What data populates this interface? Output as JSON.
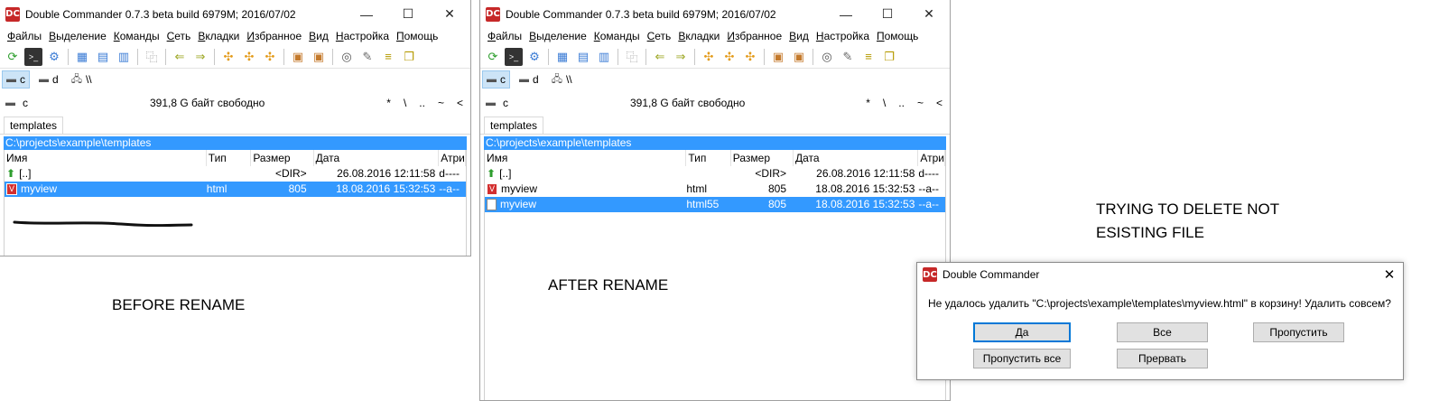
{
  "windows": [
    {
      "title": "Double Commander 0.7.3 beta build 6979M; 2016/07/02",
      "menu": [
        "Файлы",
        "Выделение",
        "Команды",
        "Сеть",
        "Вкладки",
        "Избранное",
        "Вид",
        "Настройка",
        "Помощь"
      ],
      "drives": [
        "c",
        "d",
        "\\\\"
      ],
      "current_drive": "c",
      "free_space": "391,8 G байт свободно",
      "nav_buttons": [
        "*",
        "\\",
        "..",
        "~",
        "<"
      ],
      "tab": "templates",
      "path": "C:\\projects\\example\\templates",
      "columns": [
        "Имя",
        "Тип",
        "Размер",
        "Дата",
        "Атри"
      ],
      "rows": [
        {
          "name": "[..]",
          "type": "",
          "size": "<DIR>",
          "date": "26.08.2016 12:11:58",
          "attr": "d----"
        },
        {
          "name": "myview",
          "type": "html",
          "size": "805",
          "date": "18.08.2016 15:32:53",
          "attr": "--a--"
        }
      ]
    },
    {
      "title": "Double Commander 0.7.3 beta build 6979M; 2016/07/02",
      "menu": [
        "Файлы",
        "Выделение",
        "Команды",
        "Сеть",
        "Вкладки",
        "Избранное",
        "Вид",
        "Настройка",
        "Помощь"
      ],
      "drives": [
        "c",
        "d",
        "\\\\"
      ],
      "current_drive": "c",
      "free_space": "391,8 G байт свободно",
      "nav_buttons": [
        "*",
        "\\",
        "..",
        "~",
        "<"
      ],
      "tab": "templates",
      "path": "C:\\projects\\example\\templates",
      "columns": [
        "Имя",
        "Тип",
        "Размер",
        "Дата",
        "Атри"
      ],
      "rows": [
        {
          "name": "[..]",
          "type": "",
          "size": "<DIR>",
          "date": "26.08.2016 12:11:58",
          "attr": "d----"
        },
        {
          "name": "myview",
          "type": "html",
          "size": "805",
          "date": "18.08.2016 15:32:53",
          "attr": "--a--"
        },
        {
          "name": "myview",
          "type": "html55",
          "size": "805",
          "date": "18.08.2016 15:32:53",
          "attr": "--a--"
        }
      ]
    }
  ],
  "window_buttons": {
    "minimize": "—",
    "maximize": "☐",
    "close": "✕"
  },
  "captions": {
    "before": "BEFORE RENAME",
    "after": "AFTER RENAME",
    "trying_line1": "TRYING TO DELETE  NOT",
    "trying_line2": "ESISTING FILE"
  },
  "dialog": {
    "title": "Double Commander",
    "message": "Не удалось удалить \"C:\\projects\\example\\templates\\myview.html\" в корзину! Удалить совсем?",
    "buttons": {
      "yes": "Да",
      "all": "Все",
      "skip": "Пропустить",
      "skip_all": "Пропустить все",
      "abort": "Прервать"
    }
  },
  "colors": {
    "selection": "#3399ff",
    "dialog_default_border": "#0078d7"
  }
}
